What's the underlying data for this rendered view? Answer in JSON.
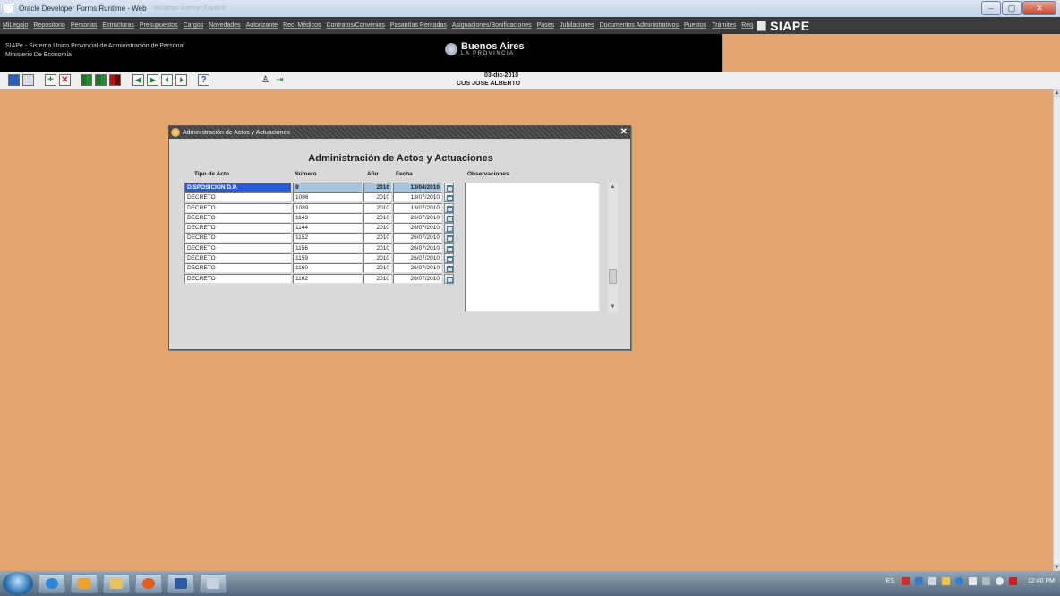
{
  "window": {
    "title": "Oracle Developer Forms Runtime - Web",
    "title_ghost": "Windows Internet Explorer"
  },
  "menu": [
    "MiLegajo",
    "Repositorio",
    "Personas",
    "Estructuras",
    "Presupuestos",
    "Cargos",
    "Novedades",
    "Autorizante",
    "Rec. Médicos",
    "Contratos/Convenios",
    "Pasantías Rentadas",
    "Asignaciones/Bonificaciones",
    "Pases",
    "Jubilaciones",
    "Documentos Administrativos",
    "Puestos",
    "Trámites",
    "Réq"
  ],
  "brand": "SIAPE",
  "header": {
    "system_name": "SIAPe - Sistema Unico Provincial de Administración de Personal",
    "ministry": "Ministerio De Economia",
    "logo_main": "Buenos Aires",
    "logo_sub": "LA PROVINCIA"
  },
  "session": {
    "date": "03-dic-2010",
    "user": "COS JOSE ALBERTO"
  },
  "dialog": {
    "title": "Administración de Actos y Actuaciones",
    "heading": "Administración de Actos y Actuaciones",
    "columns": {
      "tipo": "Tipo de Acto",
      "numero": "Número",
      "anio": "Año",
      "fecha": "Fecha",
      "obs": "Observaciones"
    },
    "rows": [
      {
        "tipo": "DISPOSICION D.P.",
        "numero": "9",
        "anio": "2010",
        "fecha": "13/04/2010"
      },
      {
        "tipo": "DECRETO",
        "numero": "1086",
        "anio": "2010",
        "fecha": "13/07/2010"
      },
      {
        "tipo": "DECRETO",
        "numero": "1089",
        "anio": "2010",
        "fecha": "13/07/2010"
      },
      {
        "tipo": "DECRETO",
        "numero": "1143",
        "anio": "2010",
        "fecha": "26/07/2010"
      },
      {
        "tipo": "DECRETO",
        "numero": "1144",
        "anio": "2010",
        "fecha": "26/07/2010"
      },
      {
        "tipo": "DECRETO",
        "numero": "1152",
        "anio": "2010",
        "fecha": "26/07/2010"
      },
      {
        "tipo": "DECRETO",
        "numero": "1156",
        "anio": "2010",
        "fecha": "26/07/2010"
      },
      {
        "tipo": "DECRETO",
        "numero": "1159",
        "anio": "2010",
        "fecha": "26/07/2010"
      },
      {
        "tipo": "DECRETO",
        "numero": "1160",
        "anio": "2010",
        "fecha": "26/07/2010"
      },
      {
        "tipo": "DECRETO",
        "numero": "1162",
        "anio": "2010",
        "fecha": "26/07/2010"
      }
    ],
    "selected_row": 0
  },
  "taskbar": {
    "lang": "ES",
    "clock": "12:40 PM"
  },
  "colors": {
    "desktop": "#e3a56d",
    "selected_field": "#2a5bd7",
    "selected_row": "#a3c3df"
  },
  "icons": [
    "save-icon",
    "print-icon",
    "insert-record-icon",
    "delete-record-icon",
    "enter-query-icon",
    "execute-query-icon",
    "cancel-query-icon",
    "first-record-icon",
    "next-record-icon",
    "previous-record-icon",
    "last-record-icon",
    "help-icon",
    "user-icon",
    "exit-icon"
  ]
}
